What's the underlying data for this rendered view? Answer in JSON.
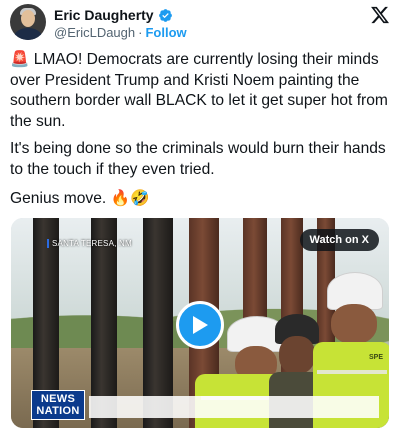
{
  "author": {
    "display_name": "Eric Daugherty",
    "handle": "@EricLDaugh",
    "separator": "·",
    "follow_label": "Follow"
  },
  "tweet": {
    "paragraph1": "🚨 LMAO! Democrats are currently losing their minds over President Trump and Kristi Noem painting the southern border wall BLACK to let it get super hot from the sun.",
    "paragraph2": "It's being done so the criminals would burn their hands to the touch if they even tried.",
    "paragraph3": "Genius move. 🔥🤣"
  },
  "video": {
    "location_label": "SANTA TERESA, NM",
    "watch_button_label": "Watch on X",
    "network_logo_line1": "NEWS",
    "network_logo_line2": "NATION",
    "vest_text": "SPE"
  },
  "colors": {
    "accent": "#1d9bf0",
    "text_primary": "#0f1419",
    "text_secondary": "#536471",
    "vest": "#c7e336",
    "network_logo": "#0b3a8c"
  },
  "icons": {
    "verified": "verified-badge-icon",
    "platform": "x-logo-icon",
    "play": "play-icon"
  }
}
